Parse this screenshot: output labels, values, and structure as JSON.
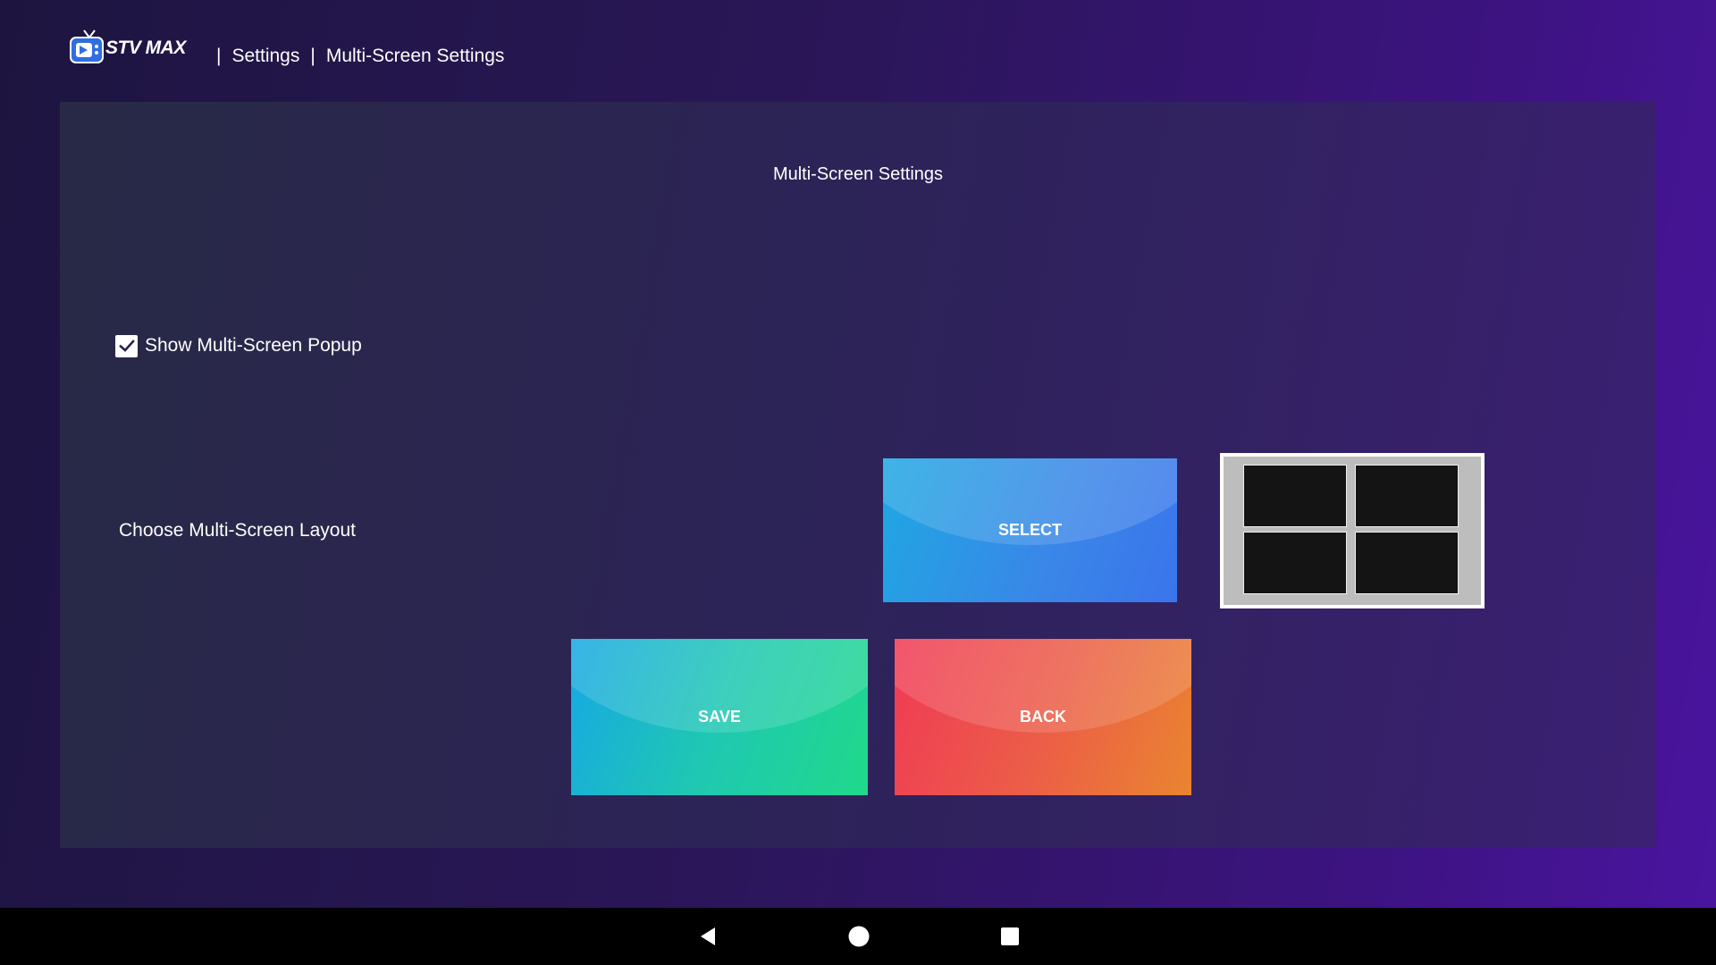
{
  "header": {
    "logo_text": "STV MAX",
    "breadcrumb": [
      "Settings",
      "Multi-Screen Settings"
    ],
    "separator": "|"
  },
  "panel": {
    "title": "Multi-Screen Settings",
    "popup_checkbox": {
      "label": "Show Multi-Screen Popup",
      "checked": true
    },
    "layout_label": "Choose Multi-Screen Layout",
    "select_button": "SELECT",
    "save_button": "SAVE",
    "back_button": "BACK",
    "selected_layout": "2x2 grid"
  },
  "navbar": {
    "icons": [
      "back-icon",
      "home-icon",
      "recents-icon"
    ]
  },
  "colors": {
    "select": "#3a86e8",
    "save": "#20d98a",
    "back": "#f03a55"
  }
}
